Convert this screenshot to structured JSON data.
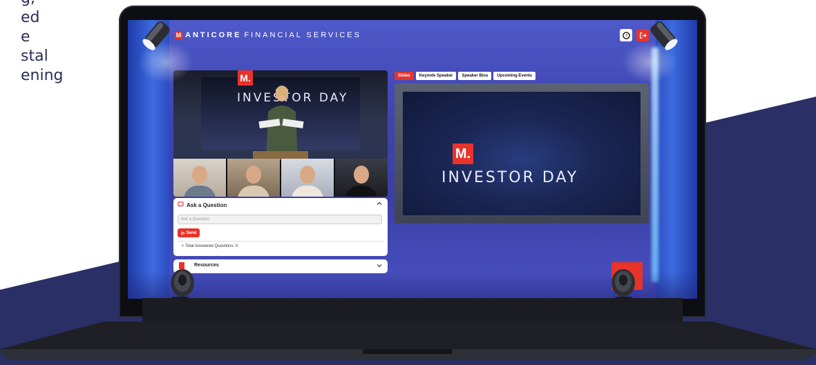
{
  "background_copy": {
    "lines": [
      "g,",
      "ed",
      "e",
      "stal",
      "ening"
    ]
  },
  "app": {
    "brand_bold": "ANTICORE",
    "brand_rest": "FINANCIAL SERVICES",
    "logo_letter": "M"
  },
  "toolbar": {
    "help_icon": "help-icon",
    "logout_icon": "logout-icon"
  },
  "video": {
    "stage_logo": "M.",
    "stage_title": "INVESTOR DAY"
  },
  "ask": {
    "heading": "Ask a Question",
    "placeholder": "Ask a Question",
    "send_label": "Send",
    "answered_label": "Total Answered Questions: 0"
  },
  "resources": {
    "heading": "Resources"
  },
  "tabs": [
    {
      "label": "Slides",
      "active": true
    },
    {
      "label": "Keynote Speaker",
      "active": false
    },
    {
      "label": "Speaker Bios",
      "active": false
    },
    {
      "label": "Upcoming Events",
      "active": false
    }
  ],
  "slide": {
    "logo": "M.",
    "title": "INVESTOR DAY"
  },
  "colors": {
    "accent": "#e8332a",
    "navy": "#2a2f66"
  }
}
